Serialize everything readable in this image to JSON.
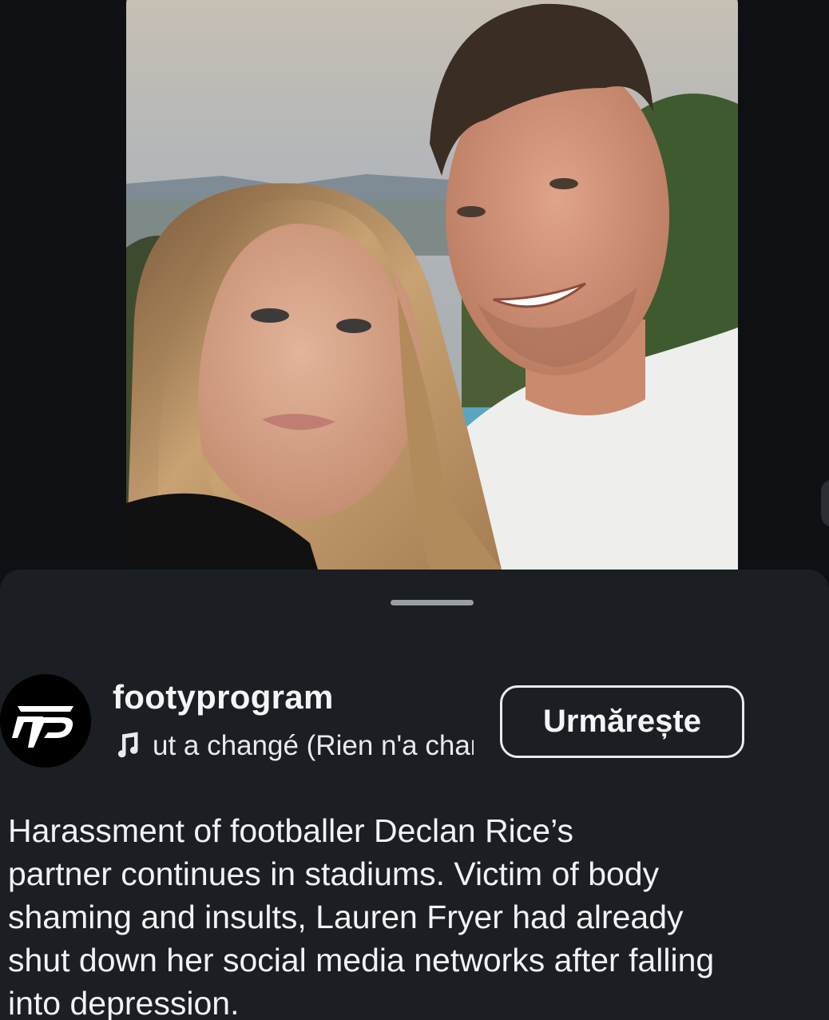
{
  "post": {
    "username": "footyprogram",
    "audio_track": "ut a changé (Rien n'a changé)",
    "follow_label": "Urmărește",
    "caption_lines": [
      "Harassment of footballer Declan Rice’s",
      "partner continues in stadiums. Victim of body",
      "shaming and insults, Lauren Fryer had already",
      "shut down her social media networks after falling",
      "into depression."
    ]
  },
  "icons": {
    "avatar_logo": "fp-logo-icon",
    "audio": "music-note-icon"
  },
  "colors": {
    "background": "#0e1013",
    "sheet": "#1b1e22",
    "text": "#f1f2f4",
    "handle": "#9a9ea3"
  }
}
